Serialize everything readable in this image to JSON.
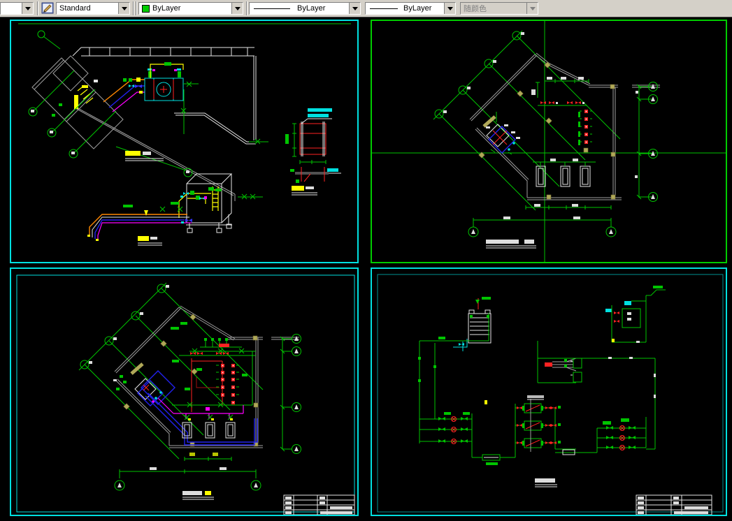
{
  "app": {
    "type": "CAD drawing workspace",
    "layout": "four tiled drawing viewports over black model space"
  },
  "toolbar": {
    "background_color": "#d4d0c8",
    "combos": {
      "unnamed": {
        "value": ""
      },
      "style": {
        "value": "Standard"
      },
      "color": {
        "value": "ByLayer",
        "swatch_color": "#00cc00"
      },
      "linetype": {
        "value": "ByLayer"
      },
      "lineweight": {
        "value": "ByLayer"
      },
      "plot_style": {
        "value": "随颜色",
        "disabled": true
      }
    }
  },
  "canvas": {
    "background_color": "#000000",
    "viewports": [
      {
        "id": "top-left",
        "content": "equipment piping plan with roof outline, rotated building, colored supply pipes, tank detail and red pipe-support detail",
        "border_color": "#00e0e0"
      },
      {
        "id": "top-right",
        "content": "site plan with diagonal column grid, grid bubbles, red valve column and three pumps",
        "border_color": "#00cc00"
      },
      {
        "id": "bottom-left",
        "content": "same site plan with dense red/magenta/blue piping and title block",
        "border_color": "#00e0e0"
      },
      {
        "id": "bottom-right",
        "content": "green water-system flow schematic with cooling tower, chillers, pump manifolds and title block",
        "border_color": "#00e0e0"
      }
    ],
    "palette": {
      "viewport_border": "#00e0e0",
      "active_border": "#00cc00",
      "drawing_green": "#00c400",
      "drawing_white": "#e6e6e6",
      "wall_gray": "#9f9f9f",
      "pipe_orange": "#ff8800",
      "pipe_blue": "#2222ee",
      "pipe_magenta": "#ff00ff",
      "pipe_yellow": "#ffff00",
      "valve_red": "#ff2222",
      "column_olive": "#b0a858",
      "label_cyan": "#00e0e0",
      "highlight_yellow": "#ffff00"
    }
  }
}
